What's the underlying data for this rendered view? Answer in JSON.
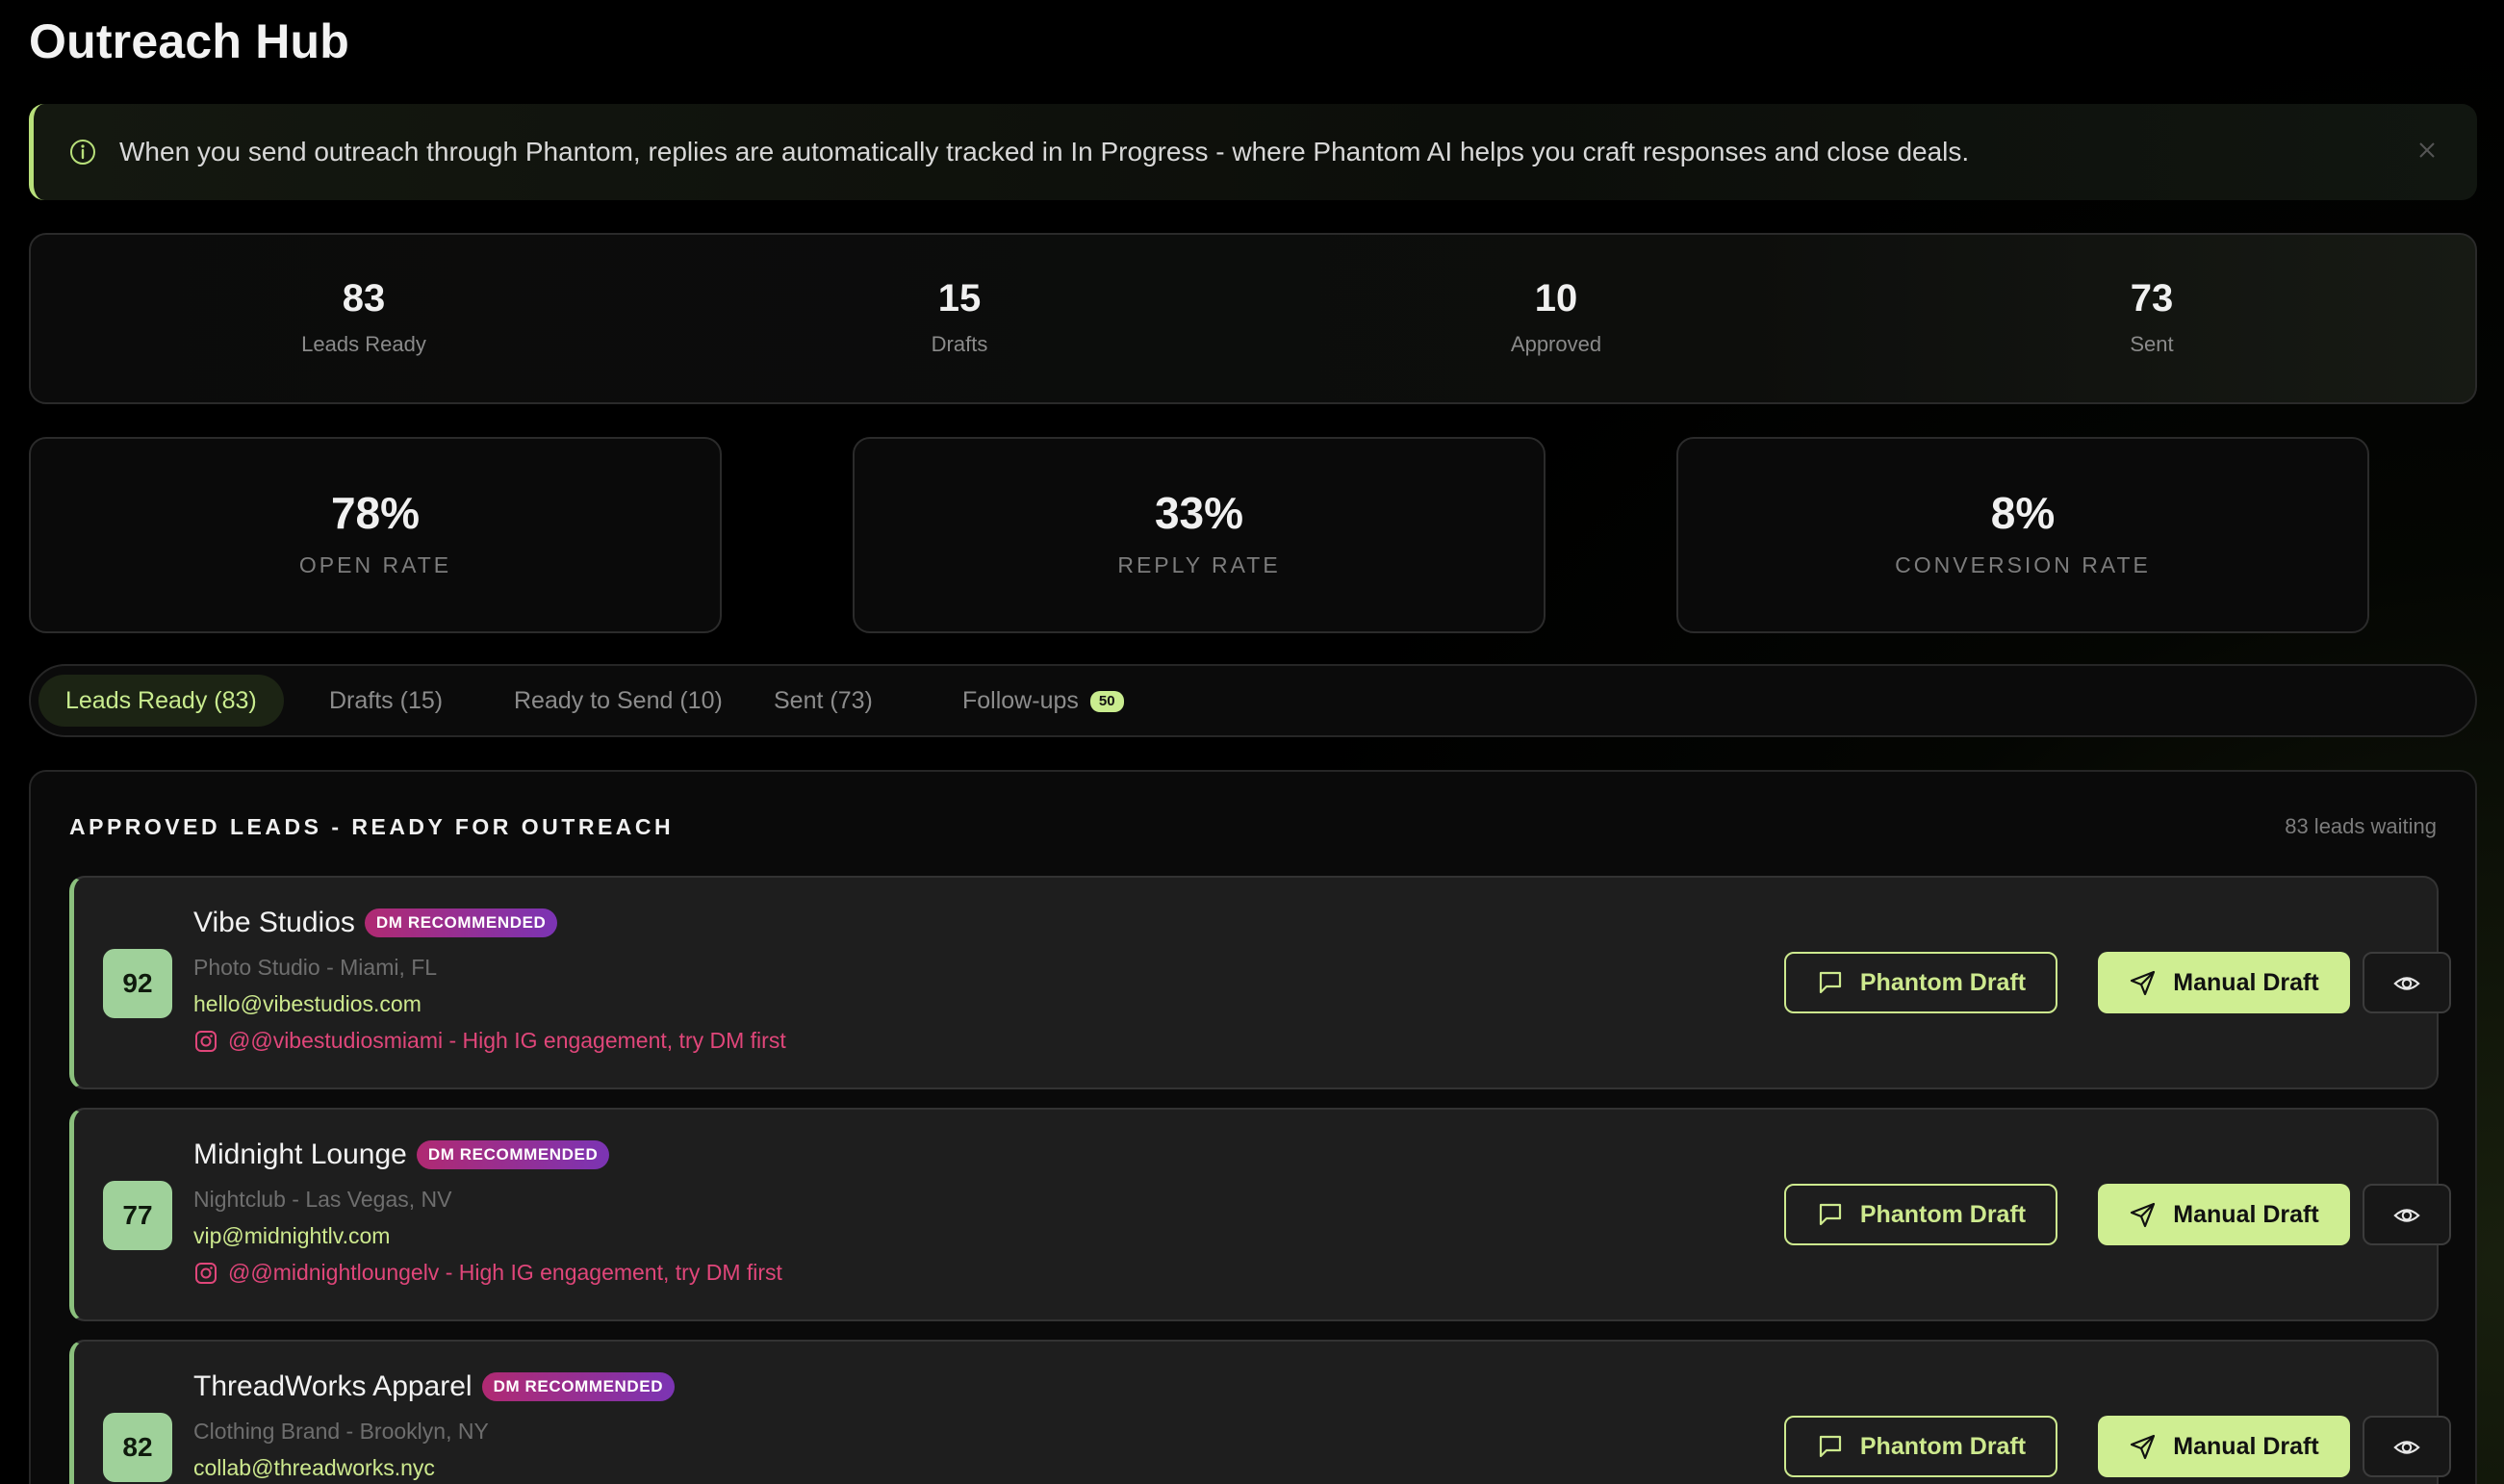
{
  "header": {
    "title": "Outreach Hub"
  },
  "banner": {
    "text": "When you send outreach through Phantom, replies are automatically tracked in In Progress - where Phantom AI helps you craft responses and close deals.",
    "icon": "info-icon",
    "close_icon": "close-icon"
  },
  "stats": [
    {
      "value": "83",
      "label": "Leads Ready"
    },
    {
      "value": "15",
      "label": "Drafts"
    },
    {
      "value": "10",
      "label": "Approved"
    },
    {
      "value": "73",
      "label": "Sent"
    }
  ],
  "rates": [
    {
      "value": "78%",
      "label": "OPEN RATE"
    },
    {
      "value": "33%",
      "label": "REPLY RATE"
    },
    {
      "value": "8%",
      "label": "CONVERSION RATE"
    }
  ],
  "tabs": [
    {
      "label": "Leads Ready (83)",
      "active": true
    },
    {
      "label": "Drafts (15)"
    },
    {
      "label": "Ready to Send (10)"
    },
    {
      "label": "Sent (73)"
    },
    {
      "label": "Follow-ups",
      "badge": "50"
    }
  ],
  "section": {
    "title": "APPROVED LEADS - READY FOR OUTREACH",
    "count": "83 leads waiting"
  },
  "leads": [
    {
      "score": "92",
      "name": "Vibe Studios",
      "badge": "DM RECOMMENDED",
      "category": "Photo Studio - Miami, FL",
      "email": "hello@vibestudios.com",
      "instagram": "@@vibestudiosmiami - High IG engagement, try DM first"
    },
    {
      "score": "77",
      "name": "Midnight Lounge",
      "badge": "DM RECOMMENDED",
      "category": "Nightclub - Las Vegas, NV",
      "email": "vip@midnightlv.com",
      "instagram": "@@midnightloungelv - High IG engagement, try DM first"
    },
    {
      "score": "82",
      "name": "ThreadWorks Apparel",
      "badge": "DM RECOMMENDED",
      "category": "Clothing Brand - Brooklyn, NY",
      "email": "collab@threadworks.nyc",
      "instagram": ""
    }
  ],
  "actions": {
    "phantom_label": "Phantom Draft",
    "manual_label": "Manual Draft"
  },
  "colors": {
    "accent": "#cde98e",
    "score_bg": "#9fd19a",
    "ig_pink": "#e0467a",
    "badge_start": "#b02a72",
    "badge_end": "#7b34b4"
  }
}
